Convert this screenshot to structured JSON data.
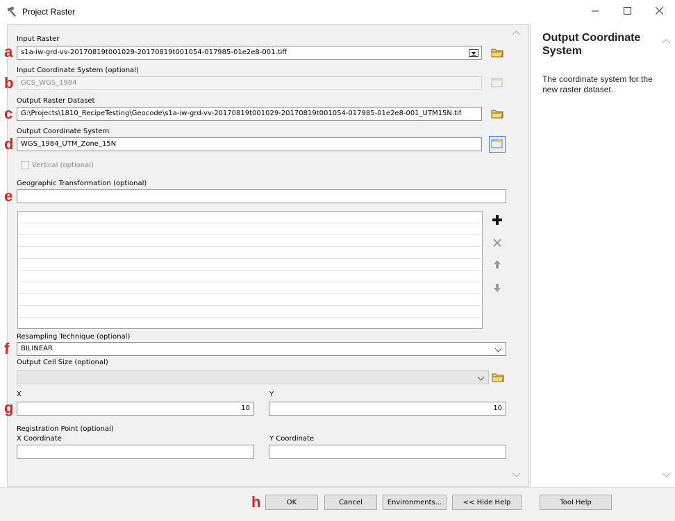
{
  "window": {
    "title": "Project Raster"
  },
  "markers": {
    "a": "a",
    "b": "b",
    "c": "c",
    "d": "d",
    "e": "e",
    "f": "f",
    "g": "g",
    "h": "h"
  },
  "form": {
    "input_raster": {
      "label": "Input Raster",
      "value": "s1a-iw-grd-vv-20170819t001029-20170819t001054-017985-01e2e8-001.tiff"
    },
    "input_coord": {
      "label": "Input Coordinate System (optional)",
      "value": "GCS_WGS_1984"
    },
    "output_raster": {
      "label": "Output Raster Dataset",
      "value": "G:\\Projects\\1810_RecipeTesting\\Geocode\\s1a-iw-grd-vv-20170819t001029-20170819t001054-017985-01e2e8-001_UTM15N.tif"
    },
    "output_coord": {
      "label": "Output Coordinate System",
      "value": "WGS_1984_UTM_Zone_15N"
    },
    "vertical": {
      "label": "Vertical (optional)",
      "checked": false
    },
    "geo_transform": {
      "label": "Geographic Transformation (optional)",
      "value": ""
    },
    "resampling": {
      "label": "Resampling Technique (optional)",
      "value": "BILINEAR"
    },
    "cell_size": {
      "label": "Output Cell Size (optional)",
      "value": ""
    },
    "x": {
      "label": "X",
      "value": "10"
    },
    "y": {
      "label": "Y",
      "value": "10"
    },
    "registration": {
      "label": "Registration Point (optional)"
    },
    "x_coord": {
      "label": "X Coordinate",
      "value": ""
    },
    "y_coord": {
      "label": "Y Coordinate",
      "value": ""
    }
  },
  "help": {
    "title": "Output Coordinate System",
    "body": "The coordinate system for the new raster dataset."
  },
  "buttons": {
    "ok": "OK",
    "cancel": "Cancel",
    "environments": "Environments...",
    "hide_help": "<< Hide Help",
    "tool_help": "Tool Help"
  },
  "colors": {
    "marker": "#e0241a",
    "selected_border": "#3b7fd8"
  },
  "icons": [
    "hammer-icon",
    "minimize-icon",
    "maximize-icon",
    "close-icon",
    "folder-icon",
    "coordinate-properties-icon",
    "add-icon",
    "remove-icon",
    "arrow-up-icon",
    "arrow-down-icon"
  ]
}
